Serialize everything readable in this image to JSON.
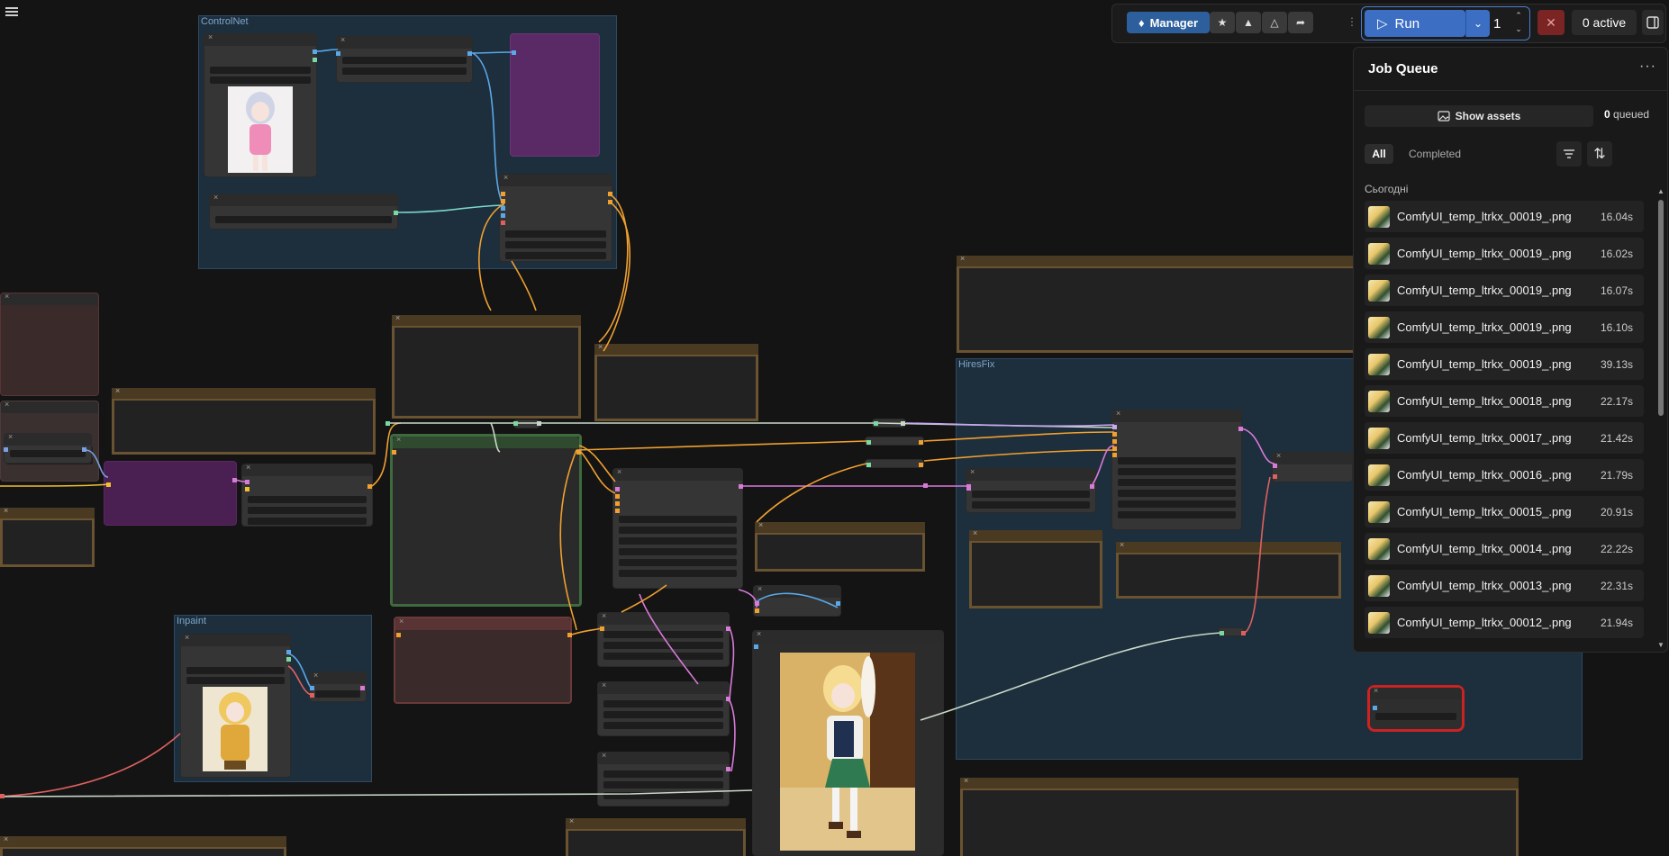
{
  "canvas": {
    "groups": {
      "controlnet": "ControlNet",
      "inpaint": "Inpaint",
      "hiresfix": "HiresFix"
    },
    "accents": {
      "group_blue": "#1e3140",
      "note_border": "#6a5330",
      "selected_outline": "#cc2222",
      "wire_orange": "#f0a030",
      "wire_blue": "#5aa8e8",
      "wire_pink": "#d87ad8",
      "wire_teal": "#7ad8c8",
      "wire_red": "#e06060"
    }
  },
  "topbar": {
    "menu_icon": "hamburger-icon",
    "manager_label": "Manager",
    "icons": [
      "star-icon",
      "pyramid-icon",
      "pyramid-alt-icon",
      "share-icon"
    ],
    "run_label": "Run",
    "run_count": "1",
    "stop_icon": "close-icon",
    "active_label": "0 active",
    "panel_icon": "panel-toggle-icon"
  },
  "job_queue": {
    "title": "Job Queue",
    "more_icon": "ellipsis-icon",
    "show_assets_label": "Show assets",
    "queued_count": "0",
    "queued_label": "queued",
    "tabs": {
      "all": "All",
      "completed": "Completed"
    },
    "day_label": "Сьогодні",
    "jobs": [
      {
        "name": "ComfyUI_temp_ltrkx_00019_.png",
        "duration": "16.04s"
      },
      {
        "name": "ComfyUI_temp_ltrkx_00019_.png",
        "duration": "16.02s"
      },
      {
        "name": "ComfyUI_temp_ltrkx_00019_.png",
        "duration": "16.07s"
      },
      {
        "name": "ComfyUI_temp_ltrkx_00019_.png",
        "duration": "16.10s"
      },
      {
        "name": "ComfyUI_temp_ltrkx_00019_.png",
        "duration": "39.13s"
      },
      {
        "name": "ComfyUI_temp_ltrkx_00018_.png",
        "duration": "22.17s"
      },
      {
        "name": "ComfyUI_temp_ltrkx_00017_.png",
        "duration": "21.42s"
      },
      {
        "name": "ComfyUI_temp_ltrkx_00016_.png",
        "duration": "21.79s"
      },
      {
        "name": "ComfyUI_temp_ltrkx_00015_.png",
        "duration": "20.91s"
      },
      {
        "name": "ComfyUI_temp_ltrkx_00014_.png",
        "duration": "22.22s"
      },
      {
        "name": "ComfyUI_temp_ltrkx_00013_.png",
        "duration": "22.31s"
      },
      {
        "name": "ComfyUI_temp_ltrkx_00012_.png",
        "duration": "21.94s"
      }
    ]
  }
}
